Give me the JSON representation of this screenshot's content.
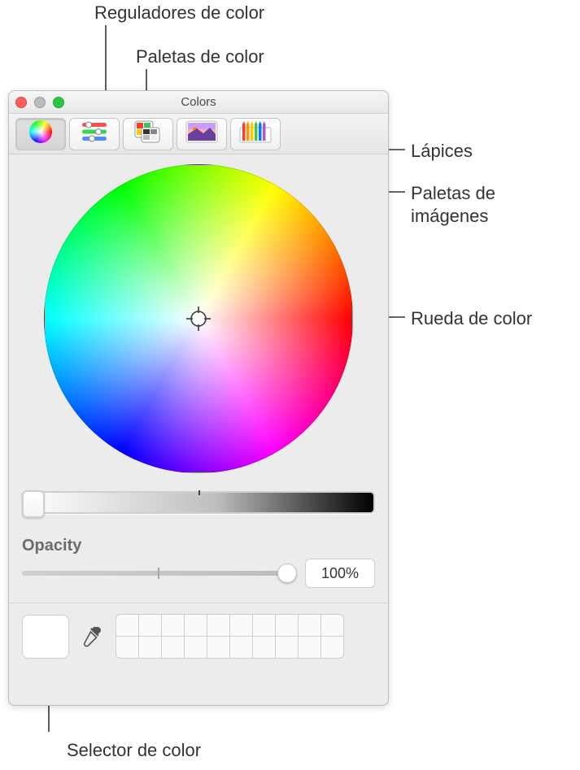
{
  "window": {
    "title": "Colors"
  },
  "traffic_lights": {
    "close": "#ff5f57",
    "minimize": "#bdbdbd",
    "zoom": "#28c940"
  },
  "toolbar": {
    "wheel_icon": "color-wheel-icon",
    "sliders_icon": "color-sliders-icon",
    "palettes_icon": "color-palettes-icon",
    "image_icon": "image-palettes-icon",
    "pencils_icon": "pencils-icon",
    "active_tab": "wheel"
  },
  "color_wheel": {
    "brightness": 100,
    "selected_color": "#ffffff"
  },
  "opacity": {
    "label": "Opacity",
    "value_display": "100%",
    "value": 100
  },
  "swatches": {
    "current": "#ffffff",
    "eyedropper_icon": "eyedropper-icon",
    "saved": [
      "",
      "",
      "",
      "",
      "",
      "",
      "",
      "",
      "",
      "",
      "",
      "",
      "",
      "",
      "",
      "",
      "",
      "",
      "",
      ""
    ]
  },
  "callouts": {
    "sliders": "Reguladores de color",
    "palettes": "Paletas de color",
    "pencils": "Lápices",
    "image_palettes": "Paletas de\nimágenes",
    "wheel": "Rueda de color",
    "picker": "Selector de color"
  }
}
